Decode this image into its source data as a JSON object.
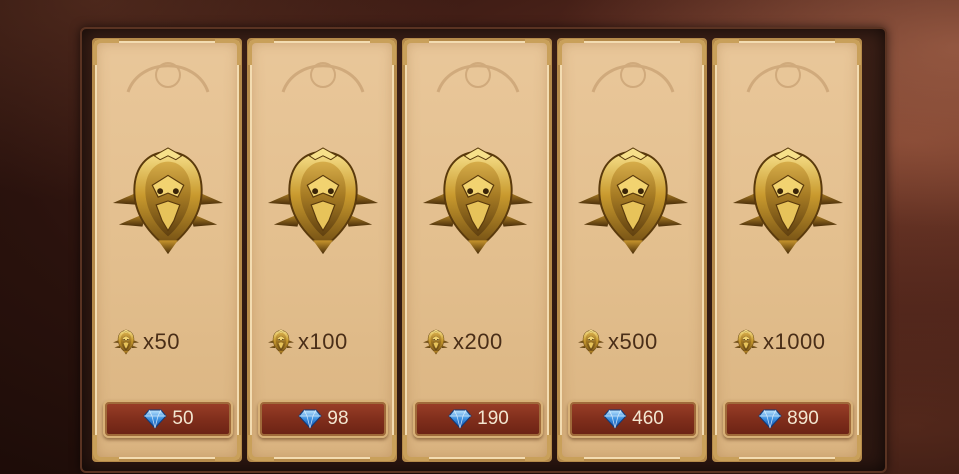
{
  "colors": {
    "card_bg": "#e3bf8e",
    "card_border": "#b58a4a",
    "button_bg": "#7e2d1b",
    "amount_text": "#4a2e18",
    "price_text": "#f3e6d0",
    "gem": "#3a8fe0"
  },
  "icons": {
    "emblem": "golden-crest-emblem-icon",
    "mini_emblem": "golden-crest-small-icon",
    "currency": "blue-diamond-gem-icon"
  },
  "offers": [
    {
      "amount": "x50",
      "price": "50"
    },
    {
      "amount": "x100",
      "price": "98"
    },
    {
      "amount": "x200",
      "price": "190"
    },
    {
      "amount": "x500",
      "price": "460"
    },
    {
      "amount": "x1000",
      "price": "890"
    }
  ]
}
